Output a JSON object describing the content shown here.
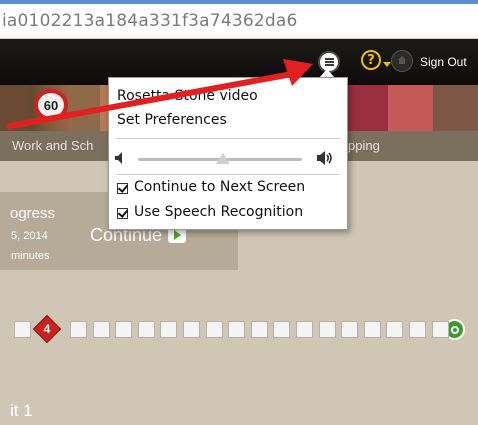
{
  "browser": {
    "url": "ia0102213a184a331f3a74362da6"
  },
  "header": {
    "sign_out_label": "Sign Out",
    "help_symbol": "?",
    "menu_icon": "list-icon",
    "home_icon": "home-icon"
  },
  "banner": {
    "speed_sign_text": "60",
    "left_label": "Work and Sch",
    "right_label": "pping"
  },
  "popup_menu": {
    "items": [
      "Rosetta Stone video",
      "Set Preferences"
    ],
    "volume": {
      "level": 0.52
    },
    "options": [
      {
        "label": "Continue to Next Screen",
        "checked": true
      },
      {
        "label": "Use Speech Recognition",
        "checked": true
      }
    ]
  },
  "progress": {
    "title": "ogress",
    "date": "5, 2014",
    "time": "minutes",
    "continue_label": "Continue"
  },
  "lesson_track": {
    "current_lesson": "4",
    "square_count": 17
  },
  "unit": {
    "label": "it 1"
  },
  "colors": {
    "annotation_arrow": "#e32020",
    "diamond_red": "#cc2121",
    "end_green": "#3f9a2d",
    "help_yellow": "#f0c000"
  }
}
